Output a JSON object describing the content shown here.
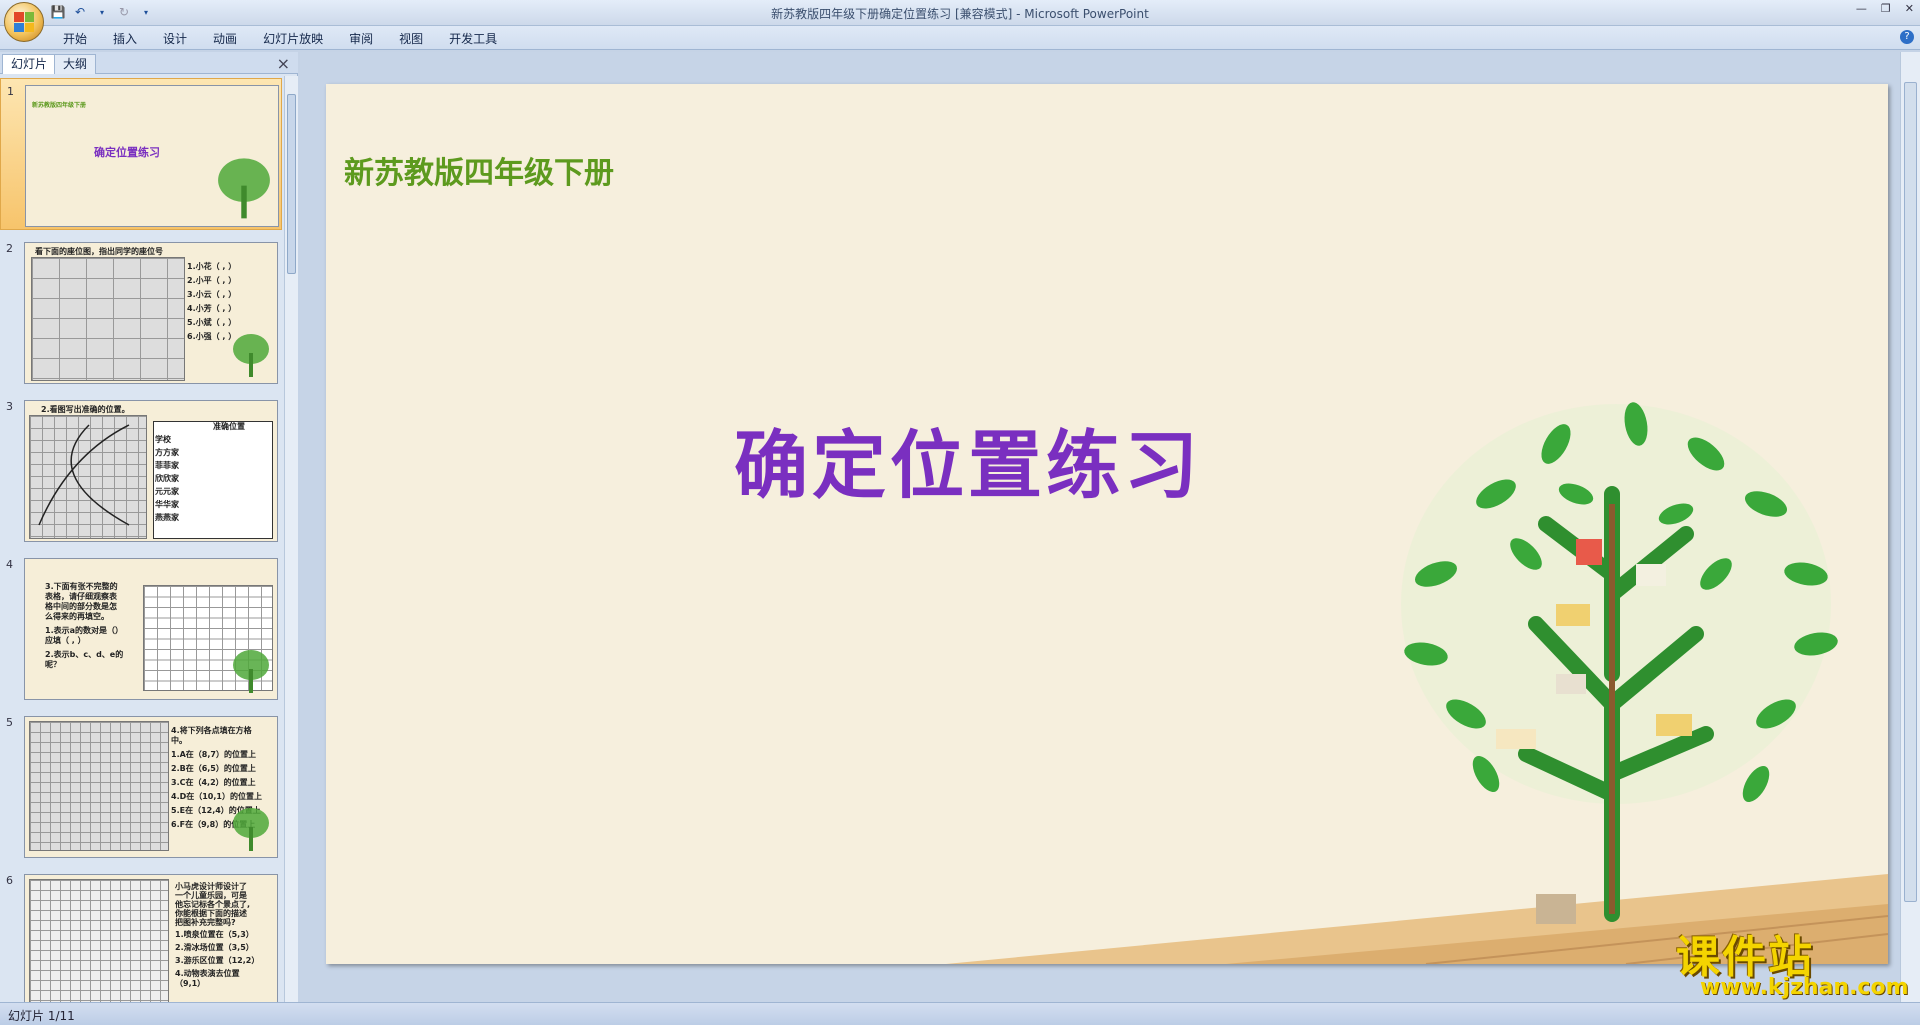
{
  "window": {
    "title": "新苏教版四年级下册确定位置练习 [兼容模式] - Microsoft PowerPoint"
  },
  "ribbon": {
    "tabs": [
      "开始",
      "插入",
      "设计",
      "动画",
      "幻灯片放映",
      "审阅",
      "视图",
      "开发工具"
    ]
  },
  "left_pane": {
    "tab_slides": "幻灯片",
    "tab_outline": "大纲",
    "thumbnails": [
      {
        "num": "1",
        "lines": [
          "新苏教版四年级下册",
          "确定位置练习"
        ]
      },
      {
        "num": "2",
        "lines": [
          "看下面的座位图，指出同学的座位号",
          "1.小花（ , ）",
          "2.小平（ , ）",
          "3.小云（ , ）",
          "4.小芳（ , ）",
          "5.小斌（ , ）",
          "6.小强（ , ）"
        ]
      },
      {
        "num": "3",
        "lines": [
          "2.看图写出准确的位置。",
          "准确位置",
          "学校",
          "方方家",
          "菲菲家",
          "欣欣家",
          "元元家",
          "华华家",
          "燕燕家"
        ]
      },
      {
        "num": "4",
        "lines": [
          "3.下面有张不完整的",
          "表格，请仔细观察表",
          "格中间的部分数是怎",
          "么得来的再填空。",
          "1.表示a的数对是（）",
          "应填（ , ）",
          "2.表示b、c、d、e的",
          "呢？"
        ]
      },
      {
        "num": "5",
        "lines": [
          "4.将下列各点填在方格",
          "中。",
          "1.A在（8,7）的位置上",
          "2.B在（6,5）的位置上",
          "3.C在（4,2）的位置上",
          "4.D在（10,1）的位置上",
          "5.E在（12,4）的位置上",
          "6.F在（9,8）的位置上"
        ]
      },
      {
        "num": "6",
        "lines": [
          "小马虎设计师设计了",
          "一个儿童乐园，可是",
          "他忘记标各个景点了,",
          "你能根据下面的描述",
          "把图补充完整吗?",
          "1.喷泉位置在（5,3）",
          "2.滑冰场位置（3,5）",
          "3.游乐区位置（12,2）",
          "4.动物表演去位置",
          "（9,1）"
        ]
      }
    ]
  },
  "slide": {
    "subtitle": "新苏教版四年级下册",
    "title": "确定位置练习"
  },
  "status_bar": {
    "text": "幻灯片 1/11"
  },
  "watermark": {
    "cn": "课件站",
    "en": "www.kjzhan.com"
  },
  "colors": {
    "subtitle": "#5d9a1e",
    "title": "#7a2fc0",
    "slide_bg": "#f6efdd",
    "selected_thumb": "#f7c46b",
    "watermark": "#f4d400"
  }
}
